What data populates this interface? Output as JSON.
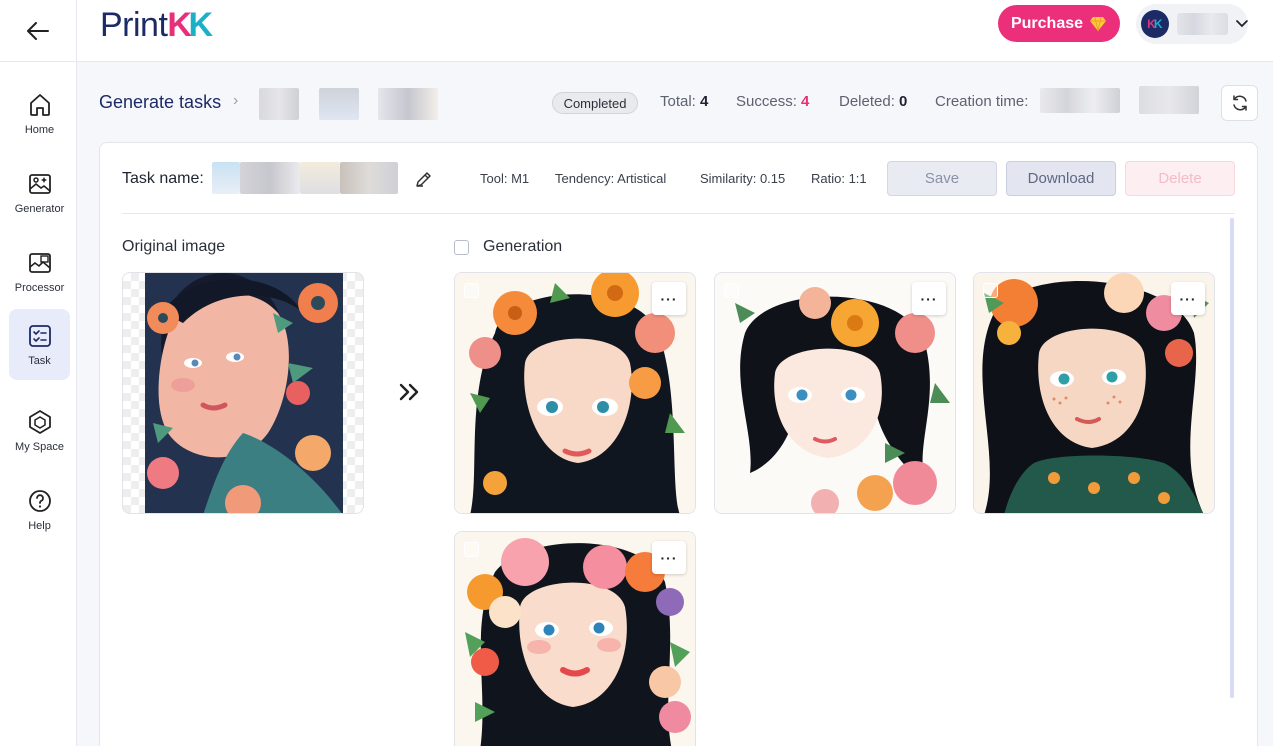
{
  "header": {
    "logo": {
      "part1": "Print",
      "part2": "K",
      "part3": "K"
    },
    "purchase_label": "Purchase",
    "avatar_letters": {
      "a": "K",
      "b": "K"
    }
  },
  "sidebar": {
    "items": [
      {
        "label": "Home",
        "icon": "home-icon",
        "active": false
      },
      {
        "label": "Generator",
        "icon": "image-sparkle-icon",
        "active": false
      },
      {
        "label": "Processor",
        "icon": "image-process-icon",
        "active": false
      },
      {
        "label": "Task",
        "icon": "task-list-icon",
        "active": true
      },
      {
        "label": "My Space",
        "icon": "cube-hexagon-icon",
        "active": false
      },
      {
        "label": "Help",
        "icon": "help-circle-icon",
        "active": false
      }
    ]
  },
  "breadcrumb": {
    "root": "Generate tasks",
    "separator": "›"
  },
  "status": {
    "badge": "Completed",
    "total_label": "Total:",
    "total": "4",
    "success_label": "Success:",
    "success": "4",
    "deleted_label": "Deleted:",
    "deleted": "0",
    "creation_label": "Creation time:"
  },
  "task": {
    "name_label": "Task name:",
    "tool": "Tool: M1",
    "tendency": "Tendency: Artistical",
    "similarity": "Similarity: 0.15",
    "ratio": "Ratio: 1:1",
    "save_label": "Save",
    "download_label": "Download",
    "delete_label": "Delete"
  },
  "sections": {
    "original_label": "Original image",
    "generation_label": "Generation"
  },
  "colors": {
    "brand_navy": "#1c2a66",
    "brand_pink": "#ec2f7b",
    "brand_cyan": "#1cb0c8",
    "active_nav_bg": "#e8ecfa"
  },
  "generated_images": [
    {
      "more_label": "···",
      "palette": "cream-orange"
    },
    {
      "more_label": "···",
      "palette": "white-pink"
    },
    {
      "more_label": "···",
      "palette": "cream-freckles"
    },
    {
      "more_label": "···",
      "palette": "cream-pink"
    }
  ]
}
